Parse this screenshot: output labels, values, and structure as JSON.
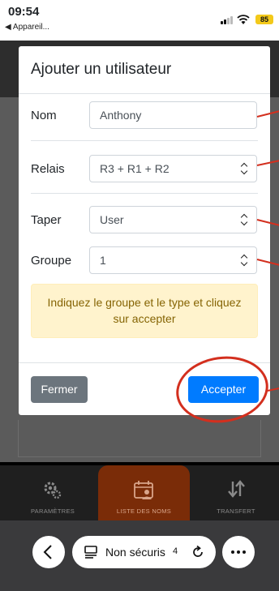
{
  "status_bar": {
    "time": "09:54",
    "back_label": "◀ Appareil...",
    "battery": "85"
  },
  "modal": {
    "title": "Ajouter un utilisateur",
    "fields": {
      "name": {
        "label": "Nom",
        "value": "Anthony"
      },
      "relays": {
        "label": "Relais",
        "value": "R3 + R1 + R2"
      },
      "type": {
        "label": "Taper",
        "value": "User"
      },
      "group": {
        "label": "Groupe",
        "value": "1"
      }
    },
    "alert_text": "Indiquez le groupe et le type et cliquez sur accepter",
    "close_label": "Fermer",
    "accept_label": "Accepter"
  },
  "tabbar": {
    "tabs": [
      {
        "label": "PARAMÈTRES",
        "icon": "gears-icon",
        "active": false
      },
      {
        "label": "LISTE DES NOMS",
        "icon": "calendar-user-icon",
        "active": true
      },
      {
        "label": "TRANSFERT",
        "icon": "transfer-arrows-icon",
        "active": false
      }
    ]
  },
  "browser": {
    "url_text": "Non sécuris",
    "url_suffix": "4"
  },
  "colors": {
    "accent": "#007bff",
    "secondary": "#6c757d",
    "annotation": "#d32f1e",
    "active_tab": "#7a2c08",
    "alert_bg": "#fff3cd"
  }
}
